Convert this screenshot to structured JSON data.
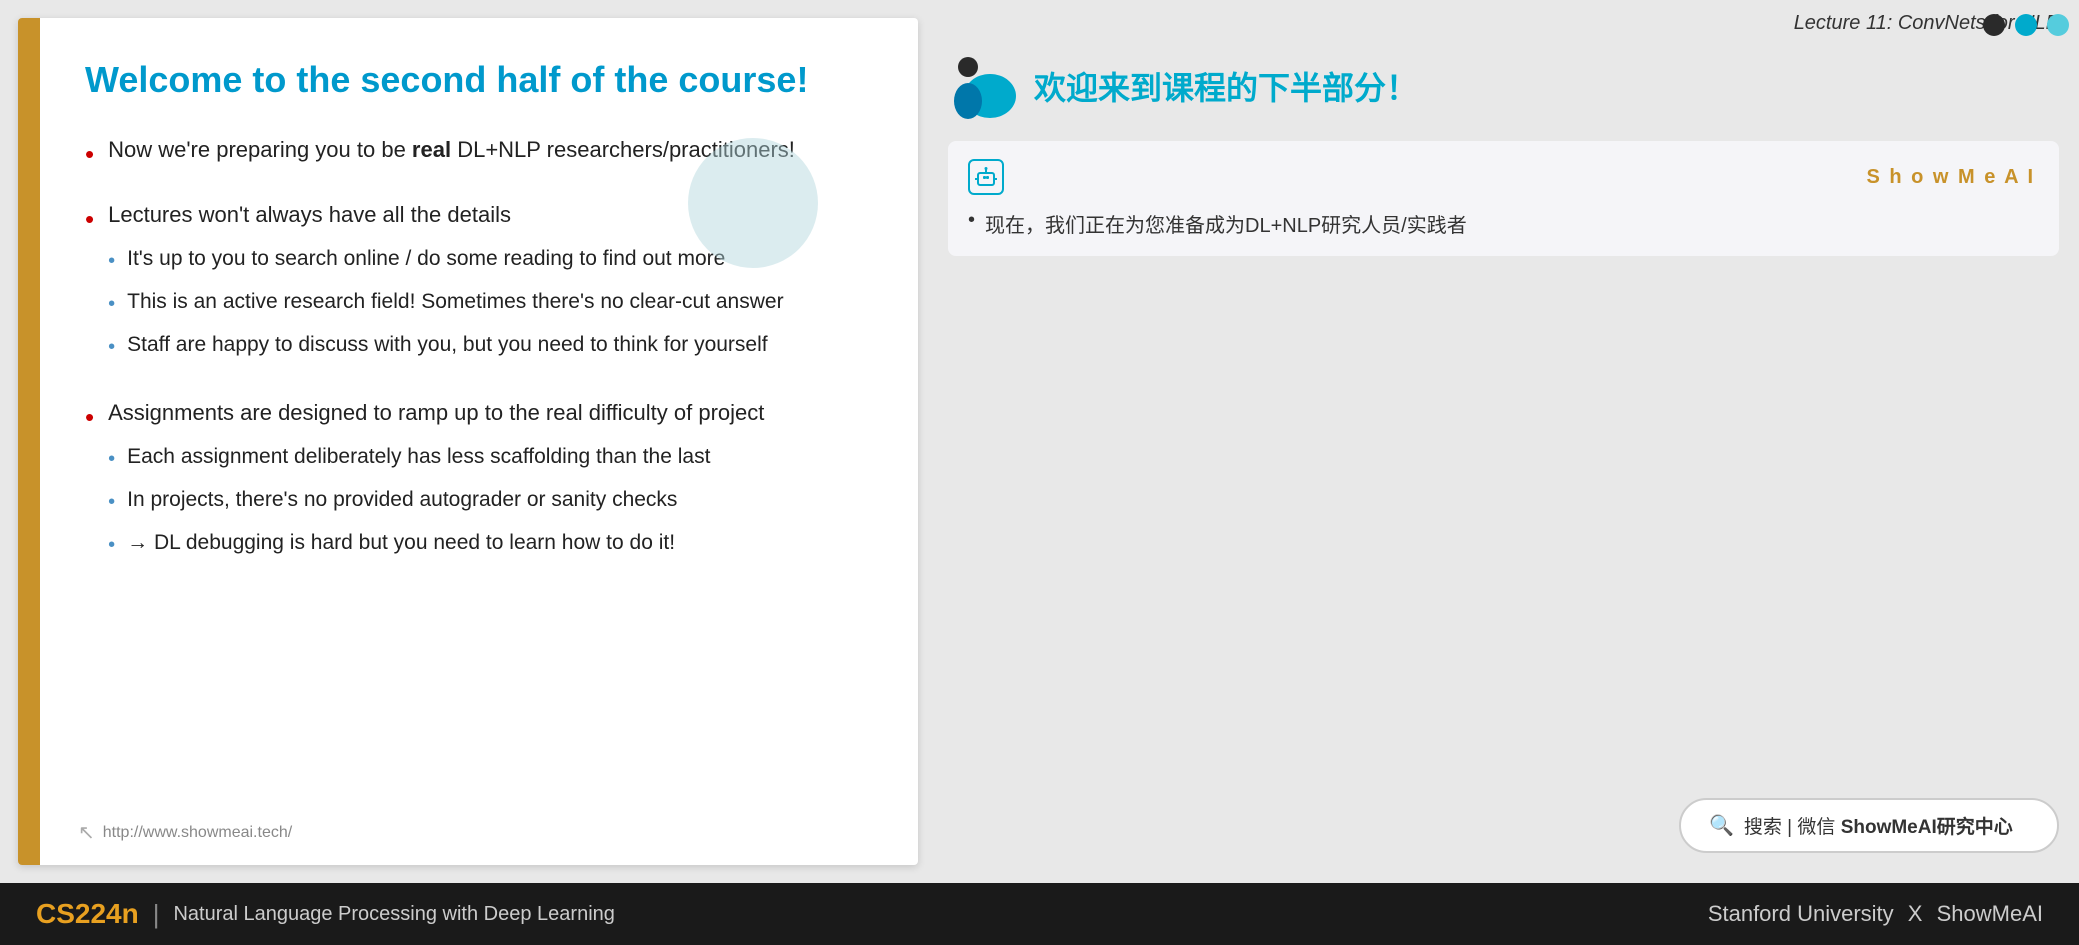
{
  "header": {
    "lecture_title": "Lecture 11: ConvNets for NLP"
  },
  "slide": {
    "title": "Welcome to the second half of the course!",
    "bullets": [
      {
        "id": 1,
        "text_before_bold": "Now we're preparing you to be ",
        "bold_text": "real",
        "text_after_bold": " DL+NLP researchers/practitioners!",
        "sub_bullets": []
      },
      {
        "id": 2,
        "text": "Lectures won't always have all the details",
        "sub_bullets": [
          "It's up to you to search online / do some reading to find out more",
          "This is an active research field! Sometimes there's no clear-cut answer",
          "Staff are happy to discuss with you, but you need to think for yourself"
        ]
      },
      {
        "id": 3,
        "text": "Assignments are designed to ramp up to the real difficulty of project",
        "sub_bullets": [
          "Each assignment deliberately has less scaffolding than the last",
          "In projects, there's no provided autograder or sanity checks",
          "→ DL debugging is hard but you need to learn how to do it!"
        ]
      }
    ],
    "url": "http://www.showmeai.tech/"
  },
  "right_panel": {
    "chinese_title": "欢迎来到课程的下半部分！",
    "translation_box": {
      "brand": "S h o w M e A I",
      "bullet": "现在，我们正在为您准备成为DL+NLP研究人员/实践者"
    }
  },
  "search": {
    "text": "搜索 | 微信 ",
    "bold_text": "ShowMeAI研究中心"
  },
  "bottom_bar": {
    "course_code": "CS224n",
    "divider": "|",
    "subtitle": "Natural Language Processing with Deep Learning",
    "right_text": "Stanford University",
    "separator": "X",
    "brand": "ShowMeAI"
  },
  "dots": [
    {
      "color": "dark"
    },
    {
      "color": "teal"
    },
    {
      "color": "teal-light"
    }
  ]
}
